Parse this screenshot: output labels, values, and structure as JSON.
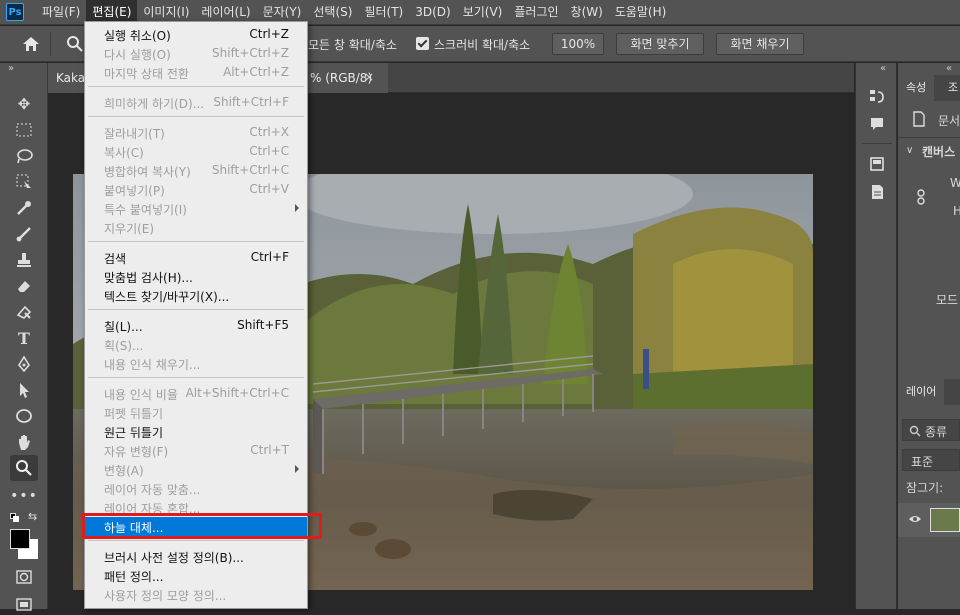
{
  "app": {
    "logo": "Ps"
  },
  "menubar": {
    "items": [
      "파일(F)",
      "편집(E)",
      "이미지(I)",
      "레이어(L)",
      "문자(Y)",
      "선택(S)",
      "필터(T)",
      "3D(D)",
      "보기(V)",
      "플러그인",
      "창(W)",
      "도움말(H)"
    ]
  },
  "options": {
    "fit_all_windows": "모든 창 확대/축소",
    "scrubby_zoom": "스크러비 확대/축소",
    "zoom_value": "100%",
    "fit_screen": "화면 맞추기",
    "fill_screen": "화면 채우기"
  },
  "doc_tab": {
    "name_prefix": "Kakao",
    "mode_suffix": "% (RGB/8)",
    "close": "×"
  },
  "right_panel": {
    "tab_properties": "속성",
    "tab_adjust": "조",
    "doc_label": "문서",
    "canvas_section": "캔버스",
    "w_label": "W",
    "h_label": "H",
    "mode_label": "모드",
    "layers_tab": "레이어",
    "search_label": "종류",
    "blend_mode": "표준",
    "lock_label": "잠그기:"
  },
  "edit_menu": {
    "items": [
      {
        "label": "실행 취소(O)",
        "shortcut": "Ctrl+Z",
        "enabled": true
      },
      {
        "label": "다시 실행(O)",
        "shortcut": "Shift+Ctrl+Z",
        "enabled": true
      },
      {
        "label": "마지막 상태 전환",
        "shortcut": "Alt+Ctrl+Z",
        "enabled": true
      },
      {
        "label": "희미하게 하기(D)...",
        "shortcut": "Shift+Ctrl+F",
        "enabled": false
      },
      {
        "label": "잘라내기(T)",
        "shortcut": "Ctrl+X",
        "enabled": false
      },
      {
        "label": "복사(C)",
        "shortcut": "Ctrl+C",
        "enabled": false
      },
      {
        "label": "병합하여 복사(Y)",
        "shortcut": "Shift+Ctrl+C",
        "enabled": false
      },
      {
        "label": "붙여넣기(P)",
        "shortcut": "Ctrl+V",
        "enabled": false
      },
      {
        "label": "특수 붙여넣기(I)",
        "shortcut": "",
        "enabled": false
      },
      {
        "label": "지우기(E)",
        "shortcut": "",
        "enabled": false
      },
      {
        "label": "검색",
        "shortcut": "Ctrl+F",
        "enabled": true
      },
      {
        "label": "맞춤법 검사(H)...",
        "shortcut": "",
        "enabled": true
      },
      {
        "label": "텍스트 찾기/바꾸기(X)...",
        "shortcut": "",
        "enabled": true
      },
      {
        "label": "칠(L)...",
        "shortcut": "Shift+F5",
        "enabled": true
      },
      {
        "label": "획(S)...",
        "shortcut": "",
        "enabled": false
      },
      {
        "label": "내용 인식 채우기...",
        "shortcut": "",
        "enabled": false
      },
      {
        "label": "내용 인식 비율",
        "shortcut": "Alt+Shift+Ctrl+C",
        "enabled": false
      },
      {
        "label": "퍼펫 뒤틀기",
        "shortcut": "",
        "enabled": false
      },
      {
        "label": "원근 뒤틀기",
        "shortcut": "",
        "enabled": true
      },
      {
        "label": "자유 변형(F)",
        "shortcut": "Ctrl+T",
        "enabled": false
      },
      {
        "label": "변형(A)",
        "shortcut": "",
        "enabled": false
      },
      {
        "label": "레이어 자동 맞춤...",
        "shortcut": "",
        "enabled": false
      },
      {
        "label": "레이어 자동 혼합...",
        "shortcut": "",
        "enabled": false
      },
      {
        "label": "하늘 대체...",
        "shortcut": "",
        "enabled": true
      },
      {
        "label": "브러시 사전 설정 정의(B)...",
        "shortcut": "",
        "enabled": true
      },
      {
        "label": "패턴 정의...",
        "shortcut": "",
        "enabled": true
      },
      {
        "label": "사용자 정의 모양 정의...",
        "shortcut": "",
        "enabled": false
      }
    ]
  }
}
